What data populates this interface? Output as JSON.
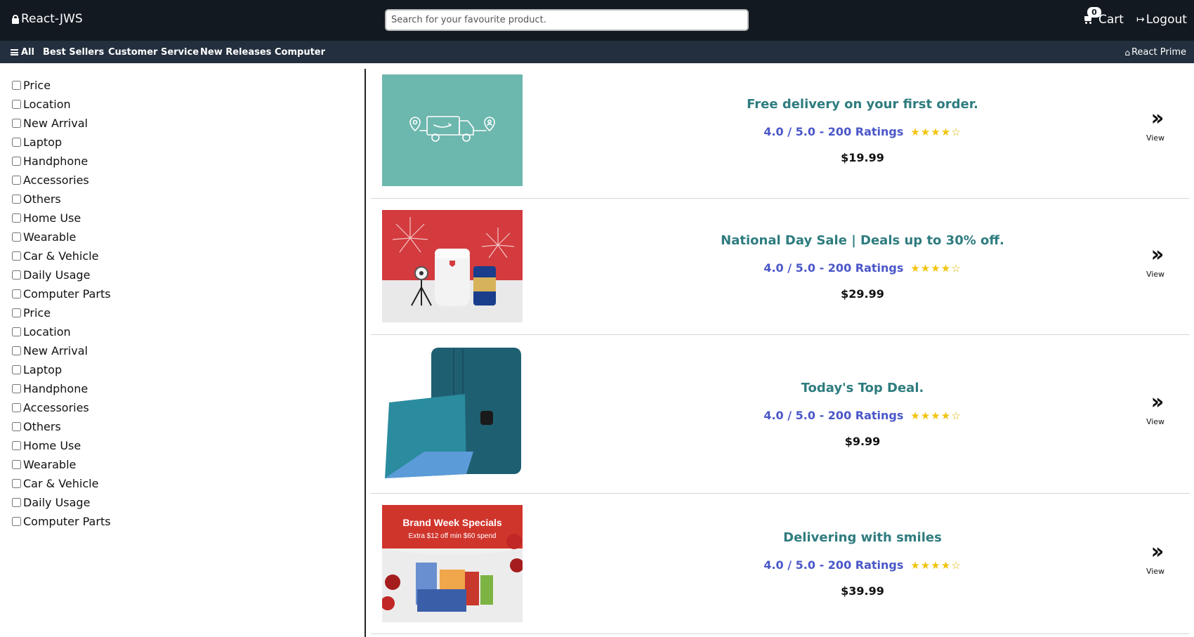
{
  "header": {
    "brand": "React-JWS",
    "search_placeholder": "Search for your favourite product.",
    "cart_count": "0",
    "cart_label": "Cart",
    "logout_label": "Logout"
  },
  "nav": {
    "all_label": "All",
    "items": [
      "Best Sellers",
      "Customer Service",
      "New Releases",
      "Computer"
    ],
    "prime_label": "React Prime"
  },
  "filters": [
    "Price",
    "Location",
    "New Arrival",
    "Laptop",
    "Handphone",
    "Accessories",
    "Others",
    "Home Use",
    "Wearable",
    "Car & Vehicle",
    "Daily Usage",
    "Computer Parts",
    "Price",
    "Location",
    "New Arrival",
    "Laptop",
    "Handphone",
    "Accessories",
    "Others",
    "Home Use",
    "Wearable",
    "Car & Vehicle",
    "Daily Usage",
    "Computer Parts"
  ],
  "products": [
    {
      "title": "Free delivery on your first order.",
      "rating": "4.0 / 5.0 - 200 Ratings",
      "stars": 4,
      "price": "$19.99",
      "view_label": "View"
    },
    {
      "title": "National Day Sale | Deals up to 30% off.",
      "rating": "4.0 / 5.0 - 200 Ratings",
      "stars": 4,
      "price": "$29.99",
      "view_label": "View"
    },
    {
      "title": "Today's Top Deal.",
      "rating": "4.0 / 5.0 - 200 Ratings",
      "stars": 4,
      "price": "$9.99",
      "view_label": "View"
    },
    {
      "title": "Delivering with smiles",
      "rating": "4.0 / 5.0 - 200 Ratings",
      "stars": 4,
      "price": "$39.99",
      "view_label": "View"
    }
  ],
  "banners": {
    "brand_week_title": "Brand Week Specials",
    "brand_week_sub": "Extra $12 off min $60 spend"
  },
  "colors": {
    "topbar": "#131921",
    "navbar": "#232f3e",
    "title": "#2e7c7f",
    "rating": "#4a57c8",
    "star": "#f1c40f"
  }
}
